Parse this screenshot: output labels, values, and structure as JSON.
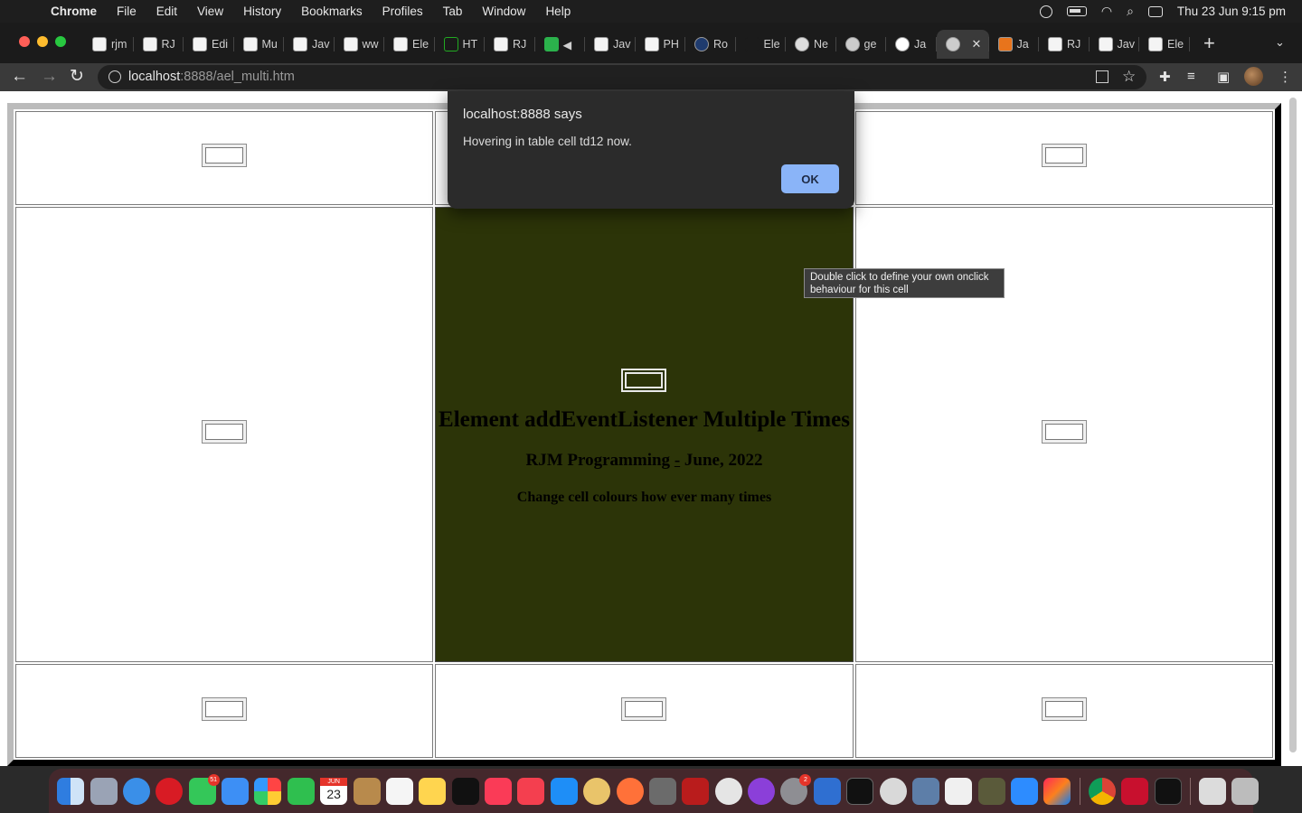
{
  "menubar": {
    "app_name": "Chrome",
    "items": [
      "File",
      "Edit",
      "View",
      "History",
      "Bookmarks",
      "Profiles",
      "Tab",
      "Window",
      "Help"
    ],
    "clock": "Thu 23 Jun  9:15 pm"
  },
  "tabs": [
    {
      "label": "rjm"
    },
    {
      "label": "RJ"
    },
    {
      "label": "Edi"
    },
    {
      "label": "Mu"
    },
    {
      "label": "Jav"
    },
    {
      "label": "ww"
    },
    {
      "label": "Ele"
    },
    {
      "label": "HT"
    },
    {
      "label": "RJ"
    },
    {
      "label": ""
    },
    {
      "label": "Jav"
    },
    {
      "label": "PH"
    },
    {
      "label": "Ro"
    },
    {
      "label": "Ele"
    },
    {
      "label": "Ne"
    },
    {
      "label": "ge"
    },
    {
      "label": "Ja"
    },
    {
      "label": ""
    },
    {
      "label": "Ja"
    },
    {
      "label": "RJ"
    },
    {
      "label": "Jav"
    },
    {
      "label": "Ele"
    }
  ],
  "toolbar": {
    "url_host": "localhost",
    "url_rest": ":8888/ael_multi.htm"
  },
  "alert": {
    "title": "localhost:8888 says",
    "message": "Hovering in table cell td12 now.",
    "ok_label": "OK"
  },
  "tooltip": {
    "text": "Double click to define your own onclick behaviour for this cell"
  },
  "center": {
    "heading": "Element addEventListener Multiple Times",
    "subheading_a": "RJM Programming ",
    "subheading_link": "-",
    "subheading_b": " June, 2022",
    "tagline": "Change cell colours how ever many times"
  },
  "colors": {
    "center_cell": "#2c3408",
    "ok_button": "#8ab4f8",
    "dialog": "#2b2b2b"
  },
  "dock": {
    "messages_badge": "51",
    "calendar_day": "23",
    "calendar_month": "JUN",
    "settings_badge": "2"
  }
}
